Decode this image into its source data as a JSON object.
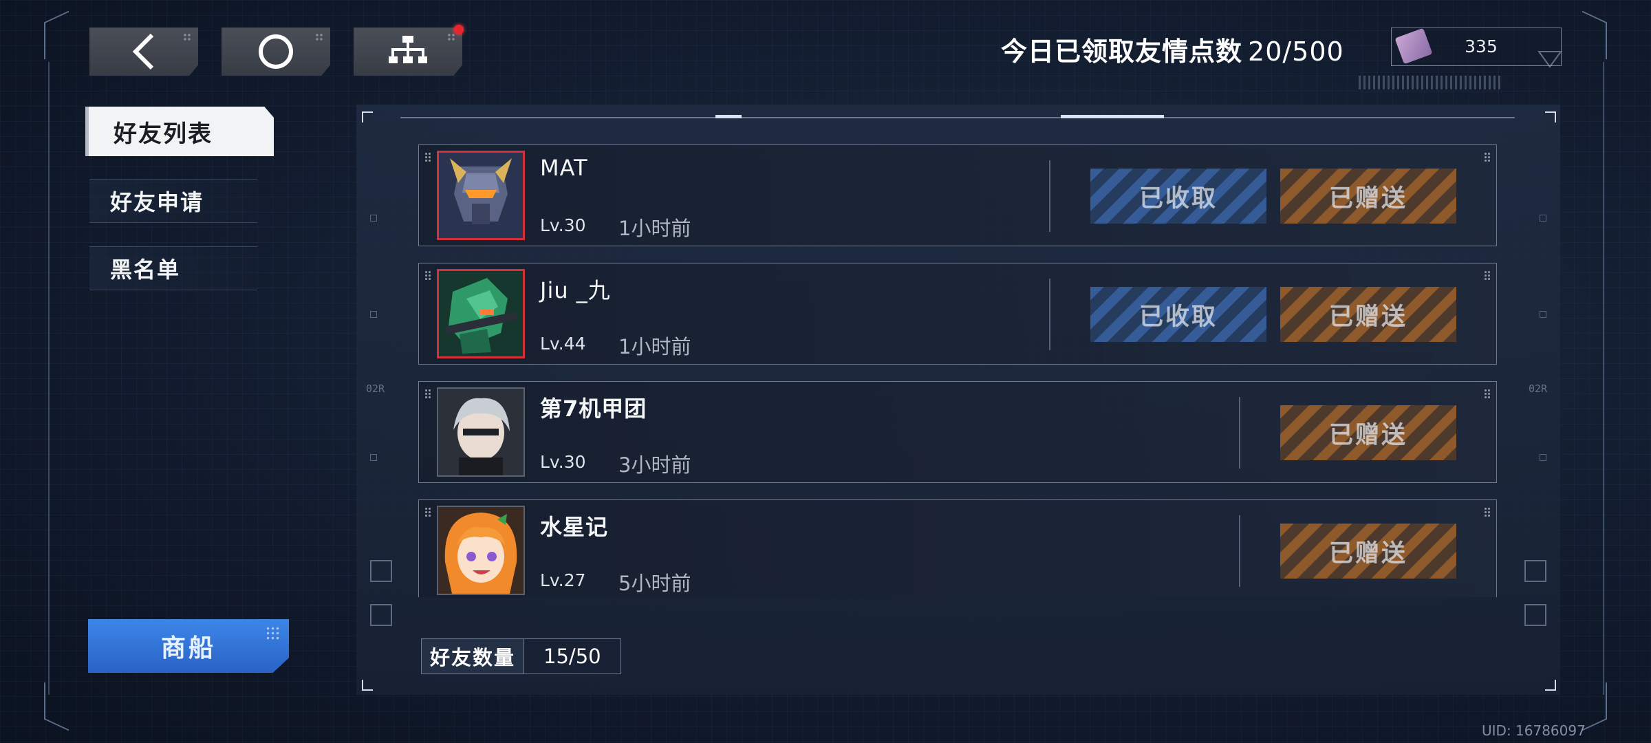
{
  "nav": {
    "back_icon": "chevron-left-icon",
    "home_icon": "circle-icon",
    "tree_icon": "hierarchy-icon",
    "notification_color": "#e8262e"
  },
  "header": {
    "friendship_label": "今日已领取友情点数",
    "friendship_value": "20/500",
    "currency_value": "335"
  },
  "sidebar": {
    "tabs": [
      {
        "label": "好友列表",
        "active": true
      },
      {
        "label": "好友申请",
        "active": false
      },
      {
        "label": "黑名单",
        "active": false
      }
    ],
    "merchant_label": "商船"
  },
  "friends": [
    {
      "name": "MAT",
      "level": "Lv.30",
      "last_seen": "1小时前",
      "received_label": "已收取",
      "sent_label": "已赠送"
    },
    {
      "name": "Jiu _九",
      "level": "Lv.44",
      "last_seen": "1小时前",
      "received_label": "已收取",
      "sent_label": "已赠送"
    },
    {
      "name": "第7机甲团",
      "level": "Lv.30",
      "last_seen": "3小时前",
      "sent_label": "已赠送"
    },
    {
      "name": "水星记",
      "level": "Lv.27",
      "last_seen": "5小时前",
      "sent_label": "已赠送"
    }
  ],
  "footer": {
    "friend_count_label": "好友数量",
    "friend_count_value": "15/50",
    "uid": "UID: 16786097"
  },
  "decor": {
    "left_code": "02R",
    "right_code": "02R"
  },
  "colors": {
    "received_button": "#355c96",
    "sent_button": "#8e5a2c",
    "merchant_button": "#3c86e8",
    "avatar_border_highlight": "#d4303a"
  }
}
